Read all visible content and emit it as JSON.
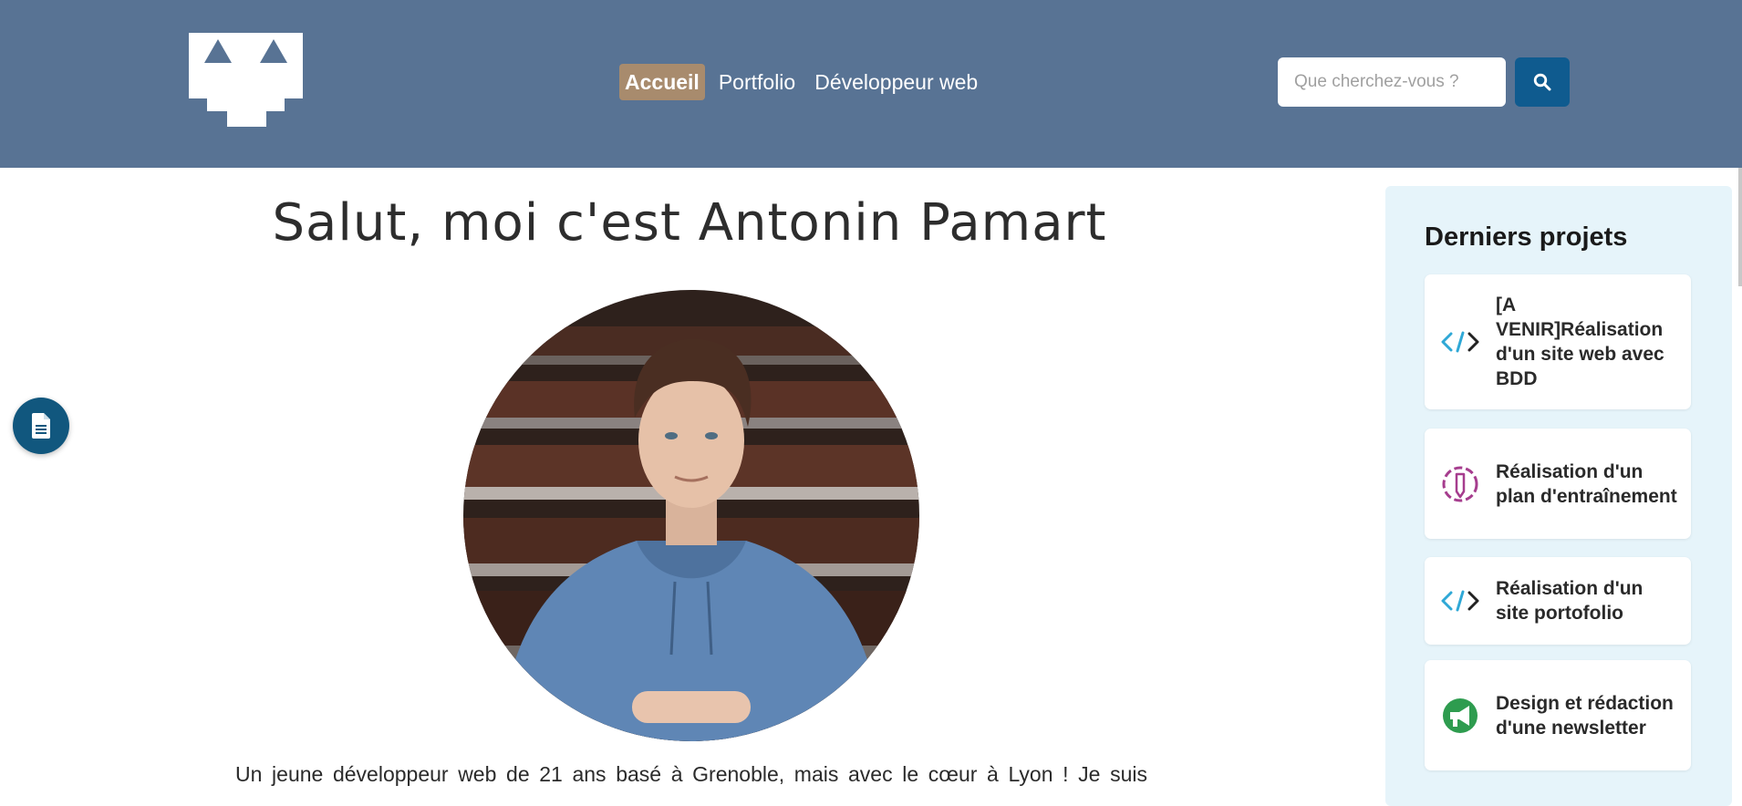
{
  "header": {
    "logo_icon": "robot-face-logo-icon",
    "nav": [
      {
        "label": "Accueil",
        "active": true
      },
      {
        "label": "Portfolio",
        "active": false
      },
      {
        "label": "Développeur web",
        "active": false
      }
    ],
    "search": {
      "placeholder": "Que cherchez-vous ?",
      "value": "",
      "button_icon": "search-icon"
    }
  },
  "main": {
    "title": "Salut, moi c'est Antonin Pamart",
    "intro_line": "Un jeune développeur web de 21 ans basé à Grenoble, mais avec le cœur à Lyon ! Je suis",
    "fab_icon": "document-icon"
  },
  "sidebar": {
    "title": "Derniers projets",
    "projects": [
      {
        "label": "[A VENIR]Réalisation d'un site web avec BDD",
        "icon": "code-icon"
      },
      {
        "label": "Réalisation d'un plan d'entraînement",
        "icon": "pencil-icon"
      },
      {
        "label": "Réalisation d'un site portofolio",
        "icon": "code-icon"
      },
      {
        "label": "Design et rédaction d'une newsletter",
        "icon": "megaphone-icon"
      }
    ]
  },
  "colors": {
    "header_bg": "#587394",
    "nav_active_bg": "#a88b6d",
    "search_button_bg": "#0f5b8f",
    "fab_bg": "#11577e",
    "sidebar_bg": "#e6f4fa"
  }
}
